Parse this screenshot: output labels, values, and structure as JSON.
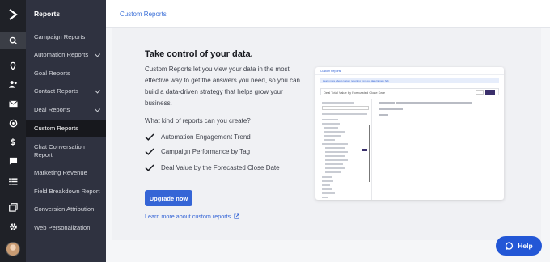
{
  "rail": {
    "icons": [
      "logo-icon",
      "search-icon",
      "location-icon",
      "contacts-icon",
      "mail-icon",
      "automation-icon",
      "deals-icon",
      "conversations-icon",
      "lists-icon",
      "pages-icon",
      "settings-icon",
      "avatar"
    ]
  },
  "sidebar": {
    "header": "Reports",
    "items": [
      {
        "label": "Campaign Reports"
      },
      {
        "label": "Automation Reports",
        "expandable": true
      },
      {
        "label": "Goal Reports"
      },
      {
        "label": "Contact Reports",
        "expandable": true
      },
      {
        "label": "Deal Reports",
        "expandable": true
      },
      {
        "label": "Custom Reports",
        "active": true
      },
      {
        "label": "Chat Conversation Report"
      },
      {
        "label": "Marketing Revenue"
      },
      {
        "label": "Field Breakdown Report"
      },
      {
        "label": "Conversion Attribution"
      },
      {
        "label": "Web Personalization"
      }
    ]
  },
  "topbar": {
    "breadcrumb": "Custom Reports"
  },
  "main": {
    "title": "Take control of your data.",
    "description": "Custom Reports let you view your data in the most effective way to get the answers you need, so you can build a data-driven strategy that helps grow your business.",
    "question": "What kind of reports can you create?",
    "checks": [
      "Automation Engagement Trend",
      "Campaign Performance by Tag",
      "Deal Value by the Forecasted Close Date"
    ],
    "upgrade_label": "Upgrade now",
    "learn_label": "Learn more about custom reports"
  },
  "preview": {
    "header": "Custom Reports",
    "banner": "Learn more about custom reporting from our data literacy hub",
    "report_title": "Deal Total Value by Forecasted Close Date"
  },
  "help": {
    "label": "Help"
  },
  "colors": {
    "accent": "#3565d6",
    "sidebar": "#2f3240",
    "rail": "#1f2127",
    "help": "#2357d6"
  }
}
